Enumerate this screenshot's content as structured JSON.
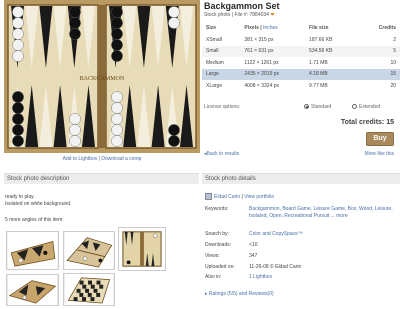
{
  "photo": {
    "title": "Backgammon Set",
    "meta": "Stock photo | File #: 7884034",
    "heart_icon": "heart-icon"
  },
  "size_table": {
    "headers": {
      "size": "Size",
      "pixels": "Pixels",
      "sep": " | ",
      "inches": "Inches",
      "file_size": "File size",
      "credits": "Credits"
    },
    "rows": [
      {
        "label": "XSmall",
        "pixels": "381 × 315 px",
        "file_size": "187.66 KB",
        "credits": "2",
        "selected": false
      },
      {
        "label": "Small",
        "pixels": "761 × 631 px",
        "file_size": "534.56 KB",
        "credits": "5",
        "selected": false
      },
      {
        "label": "Medium",
        "pixels": "1122 × 1261 px",
        "file_size": "1.71 MB",
        "credits": "10",
        "selected": false
      },
      {
        "label": "Large",
        "pixels": "2435 × 2019 px",
        "file_size": "4.18 MB",
        "credits": "15",
        "selected": true
      },
      {
        "label": "XLarge",
        "pixels": "4008 × 3324 px",
        "file_size": "9.77 MB",
        "credits": "20",
        "selected": false
      }
    ]
  },
  "license": {
    "label": "License options:",
    "standard": "Standard",
    "extended": "Extended",
    "selected": "Standard"
  },
  "total": {
    "label": "Total credits: ",
    "value": "15"
  },
  "buy_label": "Buy",
  "links": {
    "add_to_lightbox": "Add to Lightbox",
    "sep": " | ",
    "download_comp": "Download a comp",
    "back_to_results": "◂Back to results",
    "more_like_this": "More like this"
  },
  "description": {
    "header": "Stock photo description",
    "lines": [
      "ready to play.",
      "Isolated on white background."
    ],
    "angles": "5 more angles of this item:"
  },
  "details": {
    "header": "Stock photo details",
    "owner": "Eldad Carin",
    "portfolio": "View portfolio",
    "keywords_label": "Keywords:",
    "keywords": "Backgammon, Board Game, Leisure Game, Box, Wood, Leisure, Isolated, Open, Recreational Pursuit ... more",
    "search_label": "Search by:",
    "search_value": "Color and CopySpace™",
    "downloads_label": "Downloads:",
    "downloads_value": "<10",
    "views_label": "Views:",
    "views_value": "347",
    "uploaded_label": "Uploaded on:",
    "uploaded_value": "11-26-08 © Eldad Carin",
    "also_label": "Also in:",
    "also_value": "1 Lightbox",
    "ratings": "Ratings (5/5) and Reviews(0)"
  },
  "colors": {
    "accent_link": "#4a6ea8",
    "buy": "#a88a5c",
    "selected_row": "#c8d6e6"
  }
}
